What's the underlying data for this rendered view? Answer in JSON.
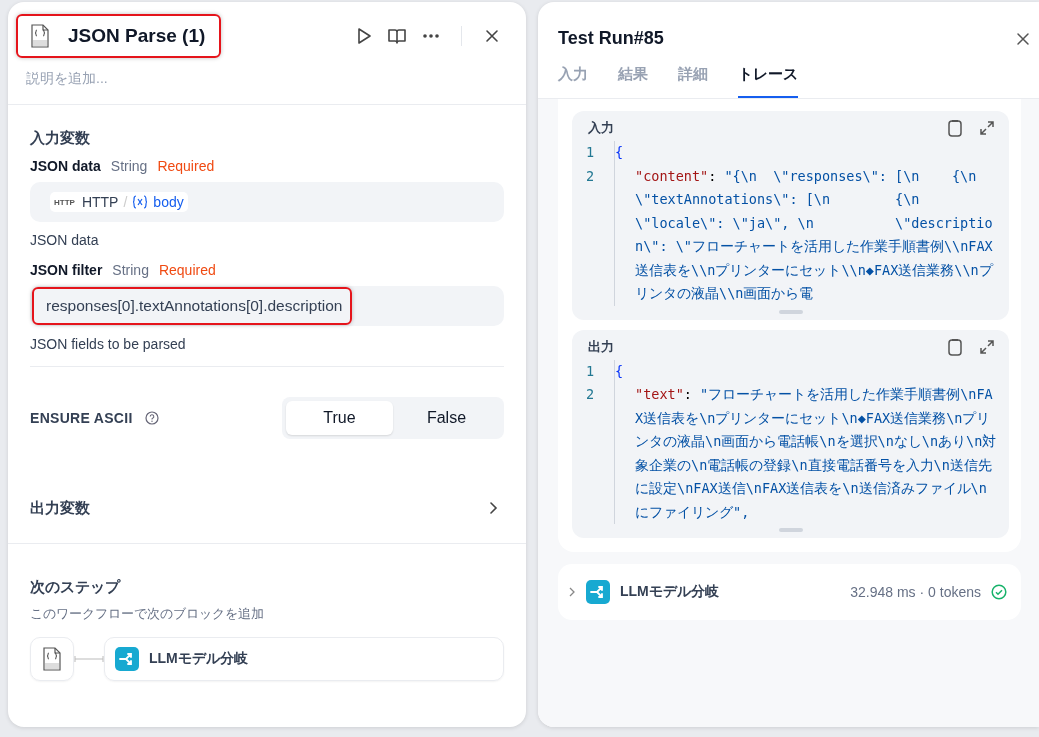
{
  "node_panel": {
    "title": "JSON Parse (1)",
    "title_highlighted": true,
    "description": {
      "placeholder": "説明を追加..."
    },
    "input_section": {
      "heading": "入力変数",
      "fields": [
        {
          "kind": "variable",
          "name": "JSON data",
          "type": "String",
          "required": "Required",
          "source_badge": "HTTP",
          "source": "HTTP",
          "separator": "/",
          "variable": "body",
          "hint": "JSON data"
        },
        {
          "kind": "text",
          "name": "JSON filter",
          "type": "String",
          "required": "Required",
          "value": "responses[0].textAnnotations[0].description",
          "highlighted": true,
          "hint": "JSON fields to be parsed"
        }
      ]
    },
    "ensure_ascii": {
      "label": "ENSURE ASCII",
      "options": [
        {
          "label": "True",
          "selected": true
        },
        {
          "label": "False",
          "selected": false
        }
      ]
    },
    "output_section": {
      "heading": "出力変数"
    },
    "next_step": {
      "heading": "次のステップ",
      "subtitle": "このワークフローで次のブロックを追加",
      "block": "LLMモデル分岐"
    }
  },
  "run_panel": {
    "title": "Test Run#85",
    "tabs": [
      {
        "label": "入力",
        "selected": false
      },
      {
        "label": "結果",
        "selected": false
      },
      {
        "label": "詳細",
        "selected": false
      },
      {
        "label": "トレース",
        "selected": true
      }
    ],
    "blocks": [
      {
        "title": "入力",
        "lines": [
          {
            "number": "1",
            "tokens": [
              {
                "kind": "brace",
                "text": "{"
              }
            ]
          },
          {
            "number": "2",
            "tokens": [
              {
                "kind": "key",
                "text": "\"content\""
              },
              {
                "kind": "punct",
                "text": ": "
              },
              {
                "kind": "string",
                "text": "\"{\\n  \\\"responses\\\": [\\n    {\\n      \\\"textAnnotations\\\": [\\n        {\\n          \\\"locale\\\": \\\"ja\\\", \\n          \\\"description\\\": \\\"フローチャートを活用した作業手順書例\\\\nFAX送信表を\\\\nプリンターにセット\\\\n◆FAX送信業務\\\\nプリンタの液晶\\\\n画面から電"
              }
            ]
          }
        ]
      },
      {
        "title": "出力",
        "lines": [
          {
            "number": "1",
            "tokens": [
              {
                "kind": "brace",
                "text": "{"
              }
            ]
          },
          {
            "number": "2",
            "tokens": [
              {
                "kind": "key",
                "text": "\"text\""
              },
              {
                "kind": "punct",
                "text": ": "
              },
              {
                "kind": "string",
                "text": "\"フローチャートを活用した作業手順書例\\nFAX送信表を\\nプリンターにセット\\n◆FAX送信業務\\nプリンタの液晶\\n画面から電話帳\\nを選択\\nなし\\nあり\\n対象企業の\\n電話帳の登録\\n直接電話番号を入力\\n送信先に設定\\nFAX送信\\nFAX送信表を\\n送信済みファイル\\nにファイリング\","
              }
            ]
          }
        ]
      }
    ],
    "trace_item": {
      "name": "LLMモデル分岐",
      "stats": "32.948 ms · 0 tokens",
      "succeeded": true
    }
  }
}
